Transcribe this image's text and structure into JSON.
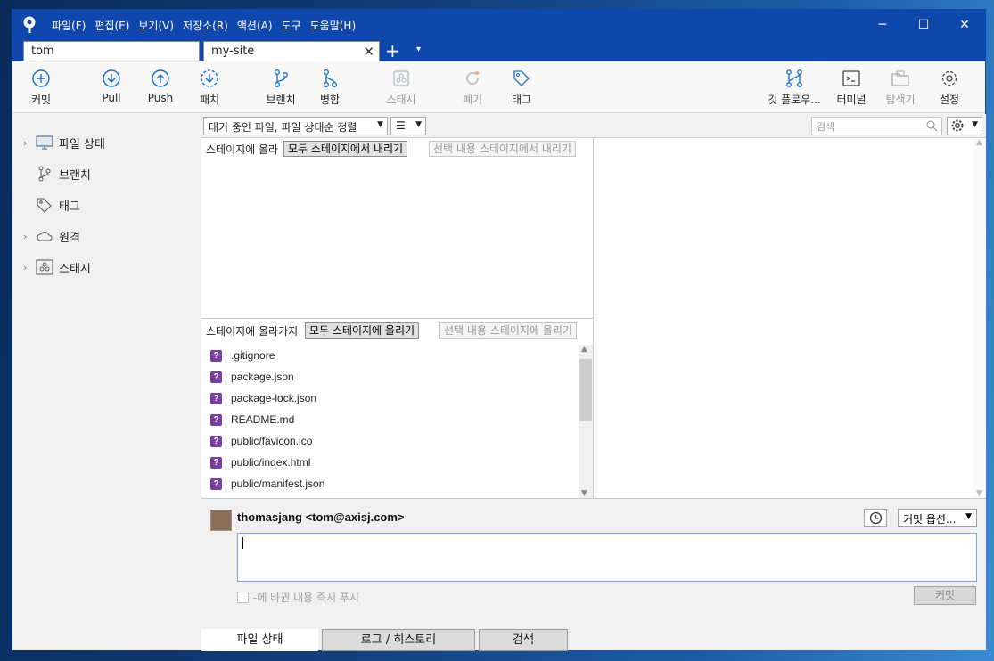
{
  "menu": [
    "파일(F)",
    "편집(E)",
    "보기(V)",
    "저장소(R)",
    "액션(A)",
    "도구",
    "도움말(H)"
  ],
  "window_controls": {
    "minimize": "─",
    "maximize": "☐",
    "close": "✕"
  },
  "tabs": [
    {
      "label": "tom"
    },
    {
      "label": "my-site",
      "close": "✕"
    }
  ],
  "tab_add": "+",
  "tab_dropdown": "▾",
  "toolbar": {
    "commit": "커밋",
    "pull": "Pull",
    "push": "Push",
    "patch": "패치",
    "branch": "브랜치",
    "merge": "병합",
    "stash": "스태시",
    "discard": "폐기",
    "tag": "태그",
    "git_flow": "깃 플로우...",
    "terminal": "터미널",
    "explorer": "탐색기",
    "settings": "설정"
  },
  "sidebar": {
    "items": [
      {
        "label": "파일 상태",
        "icon": "monitor-icon"
      },
      {
        "label": "브랜치",
        "icon": "branch-icon"
      },
      {
        "label": "태그",
        "icon": "tag-icon"
      },
      {
        "label": "원격",
        "icon": "cloud-icon"
      },
      {
        "label": "스태시",
        "icon": "stash-icon"
      }
    ]
  },
  "filter": {
    "pending_combo": "대기 중인 파일, 파일 상태순 정렬",
    "list_combo": "☰",
    "search_placeholder": "검색"
  },
  "staged": {
    "header": "스테이지에 올라",
    "unstage_all": "모두 스테이지에서 내리기",
    "unstage_selected": "선택 내용 스테이지에서 내리기"
  },
  "unstaged": {
    "header": "스테이지에 올라가지",
    "stage_all": "모두 스테이지에 올리기",
    "stage_selected": "선택 내용 스테이지에 올리기",
    "files": [
      ".gitignore",
      "package.json",
      "package-lock.json",
      "README.md",
      "public/favicon.ico",
      "public/index.html",
      "public/manifest.json"
    ]
  },
  "commit": {
    "author": "thomasjang <tom@axisj.com>",
    "options": "커밋 옵션...",
    "push_immediately": "-에 바뀐 내용 즉시 푸시",
    "commit_button": "커밋"
  },
  "bottom_tabs": [
    "파일 상태",
    "로그 / 히스토리",
    "검색"
  ],
  "colors": {
    "titlebar": "#0f47ad",
    "accent": "#1a6fc2",
    "untracked": "#7b3fa0"
  }
}
